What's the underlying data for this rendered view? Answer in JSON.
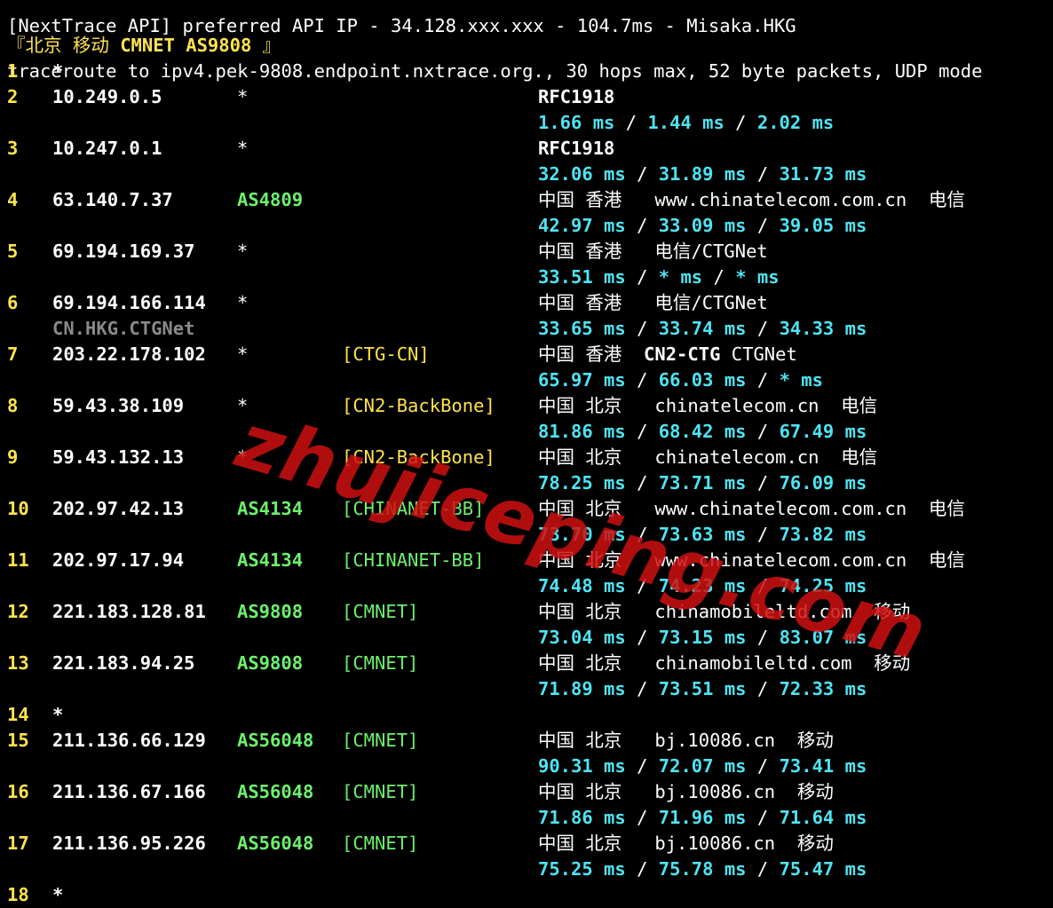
{
  "terminal": {
    "partial_header": "[NextTrace API] preferred API IP - 34.128.xxx.xxx - 104.7ms - Misaka.HKG",
    "section_open": "『",
    "section_city": "北京 移动",
    "section_label": "CMNET AS9808",
    "section_close": "』",
    "traceroute_line": "traceroute to ipv4.pek-9808.endpoint.nxtrace.org., 30 hops max, 52 byte packets, UDP mode",
    "watermark": "zhujiceping.com",
    "hops": [
      {
        "num": "1",
        "ip": "*"
      },
      {
        "num": "2",
        "ip": "10.249.0.5",
        "as": "*",
        "info": "RFC1918",
        "info_bold": true,
        "rtt": [
          "1.66 ms",
          "1.44 ms",
          "2.02 ms"
        ]
      },
      {
        "num": "3",
        "ip": "10.247.0.1",
        "as": "*",
        "info": "RFC1918",
        "info_bold": true,
        "rtt": [
          "32.06 ms",
          "31.89 ms",
          "31.73 ms"
        ]
      },
      {
        "num": "4",
        "ip": "63.140.7.37",
        "as": "AS4809",
        "info": "中国 香港   www.chinatelecom.com.cn  电信",
        "rtt": [
          "42.97 ms",
          "33.09 ms",
          "39.05 ms"
        ]
      },
      {
        "num": "5",
        "ip": "69.194.169.37",
        "as": "*",
        "info": "中国 香港   电信/CTGNet",
        "rtt": [
          "33.51 ms",
          "* ms",
          "* ms"
        ]
      },
      {
        "num": "6",
        "ip": "69.194.166.114",
        "as": "*",
        "info": "中国 香港   电信/CTGNet",
        "rdns": "CN.HKG.CTGNet",
        "rtt": [
          "33.65 ms",
          "33.74 ms",
          "34.33 ms"
        ]
      },
      {
        "num": "7",
        "ip": "203.22.178.102",
        "as": "*",
        "tag": "[CTG-CN]",
        "tag_color": "yellow",
        "info": "中国 香港  ",
        "info_bold_part": "CN2-CTG",
        "info_tail": " CTGNet",
        "rtt": [
          "65.97 ms",
          "66.03 ms",
          "* ms"
        ]
      },
      {
        "num": "8",
        "ip": "59.43.38.109",
        "as": "*",
        "tag": "[CN2-BackBone]",
        "tag_color": "yellow",
        "info": "中国 北京   chinatelecom.cn  电信",
        "rtt": [
          "81.86 ms",
          "68.42 ms",
          "67.49 ms"
        ]
      },
      {
        "num": "9",
        "ip": "59.43.132.13",
        "as": "*",
        "tag": "[CN2-BackBone]",
        "tag_color": "yellow",
        "info": "中国 北京   chinatelecom.cn  电信",
        "rtt": [
          "78.25 ms",
          "73.71 ms",
          "76.09 ms"
        ]
      },
      {
        "num": "10",
        "ip": "202.97.42.13",
        "as": "AS4134",
        "tag": "[CHINANET-BB]",
        "tag_color": "green",
        "info": "中国 北京   www.chinatelecom.com.cn  电信",
        "rtt": [
          "73.70 ms",
          "73.63 ms",
          "73.82 ms"
        ]
      },
      {
        "num": "11",
        "ip": "202.97.17.94",
        "as": "AS4134",
        "tag": "[CHINANET-BB]",
        "tag_color": "green",
        "info": "中国 北京   www.chinatelecom.com.cn  电信",
        "rtt": [
          "74.48 ms",
          "74.23 ms",
          "74.25 ms"
        ]
      },
      {
        "num": "12",
        "ip": "221.183.128.81",
        "as": "AS9808",
        "tag": "[CMNET]",
        "tag_color": "green",
        "info": "中国 北京   chinamobileltd.com  移动",
        "rtt": [
          "73.04 ms",
          "73.15 ms",
          "83.07 ms"
        ]
      },
      {
        "num": "13",
        "ip": "221.183.94.25",
        "as": "AS9808",
        "tag": "[CMNET]",
        "tag_color": "green",
        "info": "中国 北京   chinamobileltd.com  移动",
        "rtt": [
          "71.89 ms",
          "73.51 ms",
          "72.33 ms"
        ]
      },
      {
        "num": "14",
        "ip": "*"
      },
      {
        "num": "15",
        "ip": "211.136.66.129",
        "as": "AS56048",
        "tag": "[CMNET]",
        "tag_color": "green",
        "info": "中国 北京   bj.10086.cn  移动",
        "rtt": [
          "90.31 ms",
          "72.07 ms",
          "73.41 ms"
        ]
      },
      {
        "num": "16",
        "ip": "211.136.67.166",
        "as": "AS56048",
        "tag": "[CMNET]",
        "tag_color": "green",
        "info": "中国 北京   bj.10086.cn  移动",
        "rtt": [
          "71.86 ms",
          "71.96 ms",
          "71.64 ms"
        ]
      },
      {
        "num": "17",
        "ip": "211.136.95.226",
        "as": "AS56048",
        "tag": "[CMNET]",
        "tag_color": "green",
        "info": "中国 北京   bj.10086.cn  移动",
        "rtt": [
          "75.25 ms",
          "75.78 ms",
          "75.47 ms"
        ]
      },
      {
        "num": "18",
        "ip": "*"
      }
    ]
  }
}
